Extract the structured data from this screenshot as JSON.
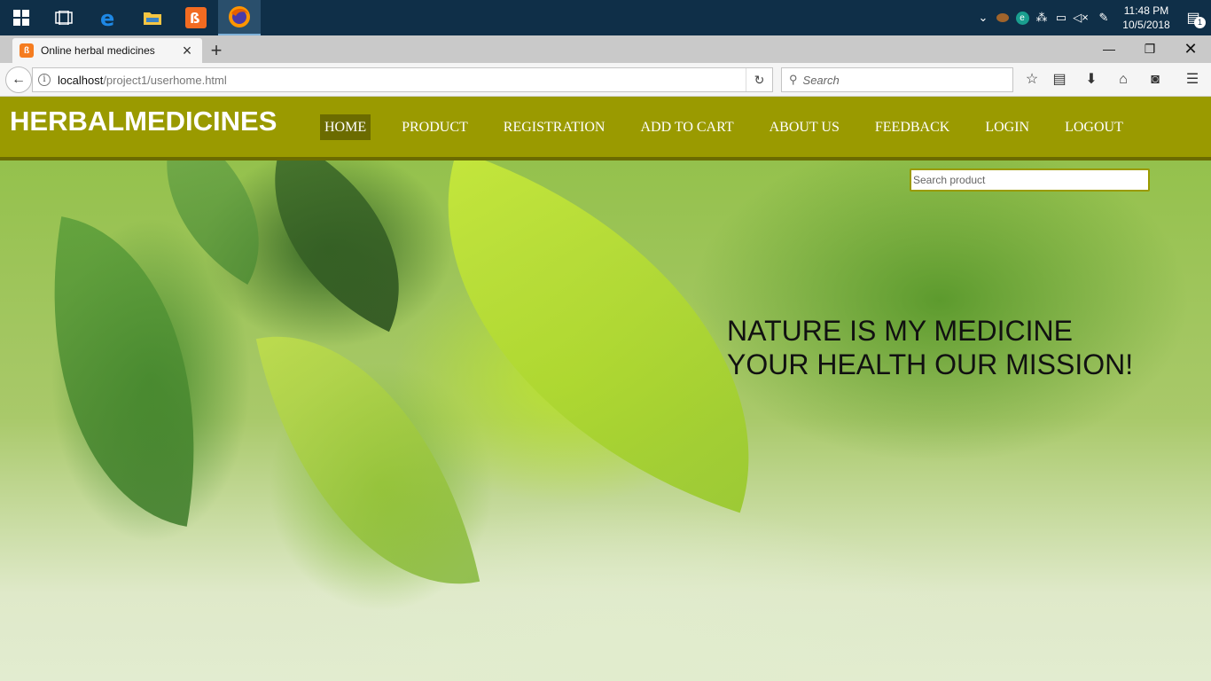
{
  "taskbar": {
    "apps": [
      {
        "name": "windows-start",
        "icon": "windows-logo-icon"
      },
      {
        "name": "task-view",
        "icon": "task-view-icon"
      },
      {
        "name": "edge",
        "icon": "edge-icon"
      },
      {
        "name": "file-explorer",
        "icon": "folder-icon"
      },
      {
        "name": "xampp",
        "icon": "xampp-icon"
      },
      {
        "name": "firefox",
        "icon": "firefox-icon"
      }
    ],
    "clock": {
      "time": "11:48 PM",
      "date": "10/5/2018"
    },
    "notification_count": "1"
  },
  "browser": {
    "tab_title": "Online herbal medicines",
    "new_tab_symbol": "+",
    "url_host": "localhost",
    "url_path": "/project1/userhome.html",
    "search_placeholder": "Search"
  },
  "site": {
    "logo": "HERBALMEDICINES",
    "menu": [
      "HOME",
      "PRODUCT",
      "REGISTRATION",
      "ADD TO CART",
      "ABOUT US",
      "FEEDBACK",
      "LOGIN",
      "LOGOUT"
    ],
    "active_menu": "HOME",
    "search_placeholder": "Search product",
    "tagline_1": "NATURE IS MY MEDICINE",
    "tagline_2": "YOUR HEALTH OUR MISSION!"
  },
  "colors": {
    "header_bg": "#9a9a00",
    "header_active": "#6b6b00",
    "taskbar": "#0f2f48"
  }
}
